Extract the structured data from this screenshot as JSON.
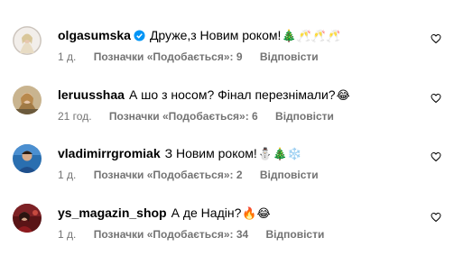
{
  "comments": [
    {
      "username": "olgasumska",
      "verified": true,
      "text": "Друже,з Новим роком!",
      "emoji": "🎄🥂🥂🥂",
      "time": "1 д.",
      "likes_label": "Позначки «Подобається»: 9",
      "reply_label": "Відповісти"
    },
    {
      "username": "leruusshaa",
      "verified": false,
      "text": "А шо з носом? Фінал перезнімали?",
      "emoji": "😂",
      "time": "21 год.",
      "likes_label": "Позначки «Подобається»: 6",
      "reply_label": "Відповісти"
    },
    {
      "username": "vladimirrgromiak",
      "verified": false,
      "text": "З Новим роком!",
      "emoji": "⛄🎄❄️",
      "time": "1 д.",
      "likes_label": "Позначки «Подобається»: 2",
      "reply_label": "Відповісти"
    },
    {
      "username": "ys_magazin_shop",
      "verified": false,
      "text": "А де Надін?",
      "emoji": "🔥😂",
      "time": "1 д.",
      "likes_label": "Позначки «Подобається»: 34",
      "reply_label": "Відповісти"
    }
  ],
  "colors": {
    "text": "#000000",
    "meta": "#737373",
    "verified": "#0095f6"
  },
  "icons": {
    "verified": "verified-badge-icon",
    "like": "heart-outline-icon"
  }
}
